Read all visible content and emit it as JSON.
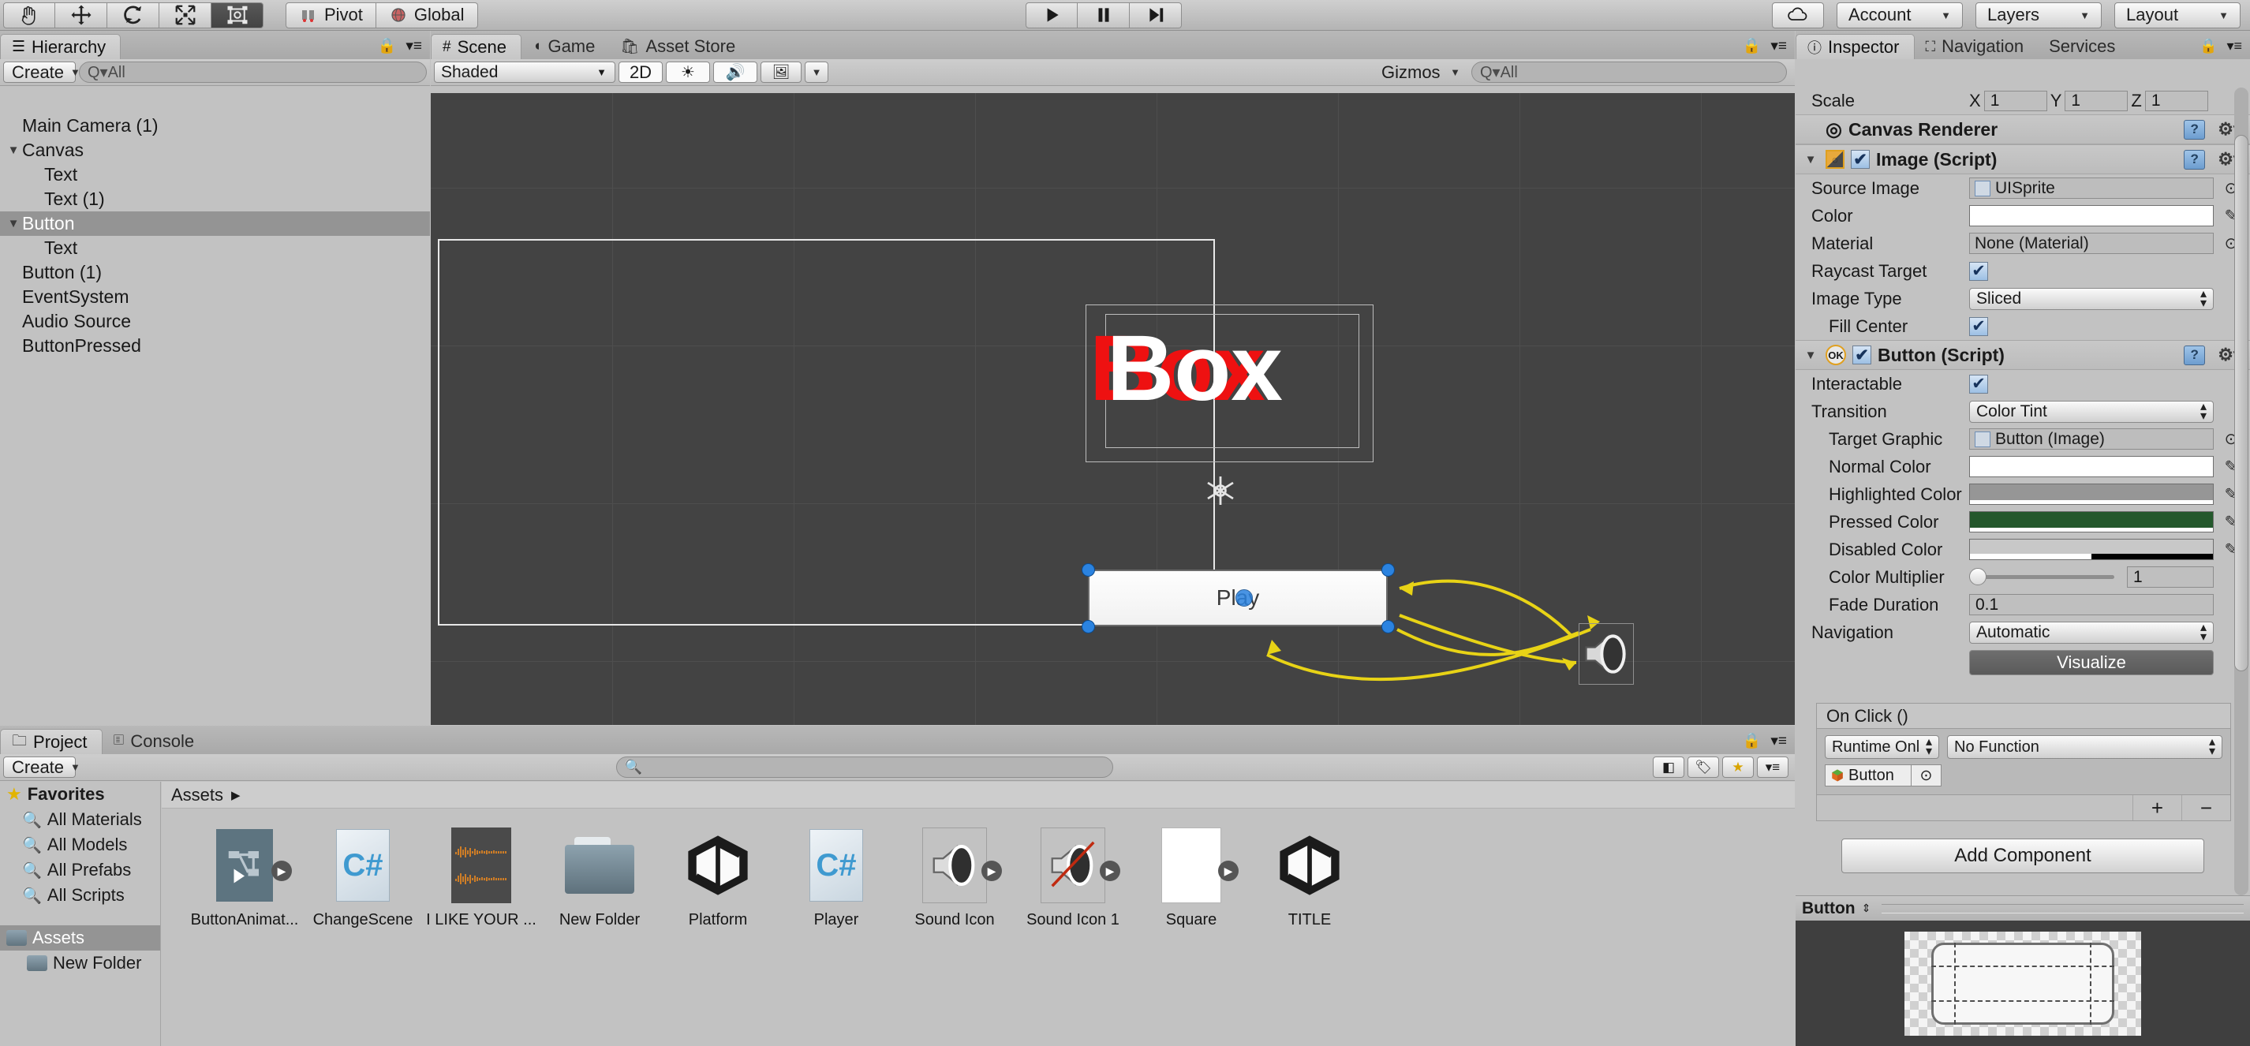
{
  "toolbar": {
    "tools": [
      {
        "name": "hand-tool",
        "glyph": "✋"
      },
      {
        "name": "move-tool",
        "glyph": "✥"
      },
      {
        "name": "rotate-tool",
        "glyph": "↻"
      },
      {
        "name": "scale-tool",
        "glyph": "⤢"
      },
      {
        "name": "rect-tool",
        "glyph": "⬚"
      }
    ],
    "pivot_label": "Pivot",
    "global_label": "Global",
    "play_label": "▶",
    "pause_label": "❚❚",
    "step_label": "▶❘",
    "cloud_label": "☁",
    "account_label": "Account",
    "layers_label": "Layers",
    "layout_label": "Layout"
  },
  "hierarchy": {
    "tab_label": "Hierarchy",
    "create_label": "Create",
    "search_placeholder": "Q▾All",
    "items": [
      {
        "label": "Main Camera (1)",
        "indent": 0,
        "foldout": "",
        "selected": false
      },
      {
        "label": "Canvas",
        "indent": 0,
        "foldout": "▼",
        "selected": false
      },
      {
        "label": "Text",
        "indent": 1,
        "foldout": "",
        "selected": false
      },
      {
        "label": "Text (1)",
        "indent": 1,
        "foldout": "",
        "selected": false
      },
      {
        "label": "Button",
        "indent": 0,
        "foldout": "▼",
        "selected": true
      },
      {
        "label": "Text",
        "indent": 1,
        "foldout": "",
        "selected": false
      },
      {
        "label": "Button (1)",
        "indent": 0,
        "foldout": "",
        "selected": false
      },
      {
        "label": "EventSystem",
        "indent": 0,
        "foldout": "",
        "selected": false
      },
      {
        "label": "Audio Source",
        "indent": 0,
        "foldout": "",
        "selected": false
      },
      {
        "label": "ButtonPressed",
        "indent": 0,
        "foldout": "",
        "selected": false
      }
    ]
  },
  "scene": {
    "tabs": [
      {
        "label": "Scene",
        "icon": "grid-icon",
        "active": true
      },
      {
        "label": "Game",
        "icon": "gamepad-icon",
        "active": false
      },
      {
        "label": "Asset Store",
        "icon": "store-icon",
        "active": false
      }
    ],
    "shading_mode": "Shaded",
    "mode_2d": "2D",
    "lighting_icon": "☀",
    "audio_icon": "🔊",
    "effects_icon": "🖼",
    "gizmos_label": "Gizmos",
    "search_placeholder": "Q▾All",
    "box_text": "Box",
    "play_button_text": "Play"
  },
  "inspector": {
    "tabs": [
      {
        "label": "Inspector",
        "active": true
      },
      {
        "label": "Navigation",
        "active": false
      },
      {
        "label": "Services",
        "active": false
      }
    ],
    "scale": {
      "label": "Scale",
      "x_label": "X",
      "x": "1",
      "y_label": "Y",
      "y": "1",
      "z_label": "Z",
      "z": "1"
    },
    "components": [
      {
        "name": "Canvas Renderer",
        "icon": "target-icon",
        "has_foldout": false,
        "has_checkbox": false,
        "rows": []
      },
      {
        "name": "Image (Script)",
        "icon": "image-script-icon",
        "has_foldout": true,
        "has_checkbox": true,
        "checked": true,
        "rows": [
          {
            "label": "Source Image",
            "type": "object",
            "value": "UISprite",
            "icon": "sprite-icon",
            "indent": 0
          },
          {
            "label": "Color",
            "type": "color",
            "value": "#ffffff",
            "indent": 0
          },
          {
            "label": "Material",
            "type": "object",
            "value": "None (Material)",
            "icon": "",
            "indent": 0
          },
          {
            "label": "Raycast Target",
            "type": "checkbox",
            "value": true,
            "indent": 0
          },
          {
            "label": "Image Type",
            "type": "popup",
            "value": "Sliced",
            "indent": 0
          },
          {
            "label": "Fill Center",
            "type": "checkbox",
            "value": true,
            "indent": 1
          }
        ]
      },
      {
        "name": "Button (Script)",
        "icon": "ok-script-icon",
        "has_foldout": true,
        "has_checkbox": true,
        "checked": true,
        "rows": [
          {
            "label": "Interactable",
            "type": "checkbox",
            "value": true,
            "indent": 0
          },
          {
            "label": "Transition",
            "type": "popup",
            "value": "Color Tint",
            "indent": 0
          },
          {
            "label": "Target Graphic",
            "type": "object",
            "value": "Button (Image)",
            "icon": "sprite-icon",
            "indent": 1
          },
          {
            "label": "Normal Color",
            "type": "color",
            "value": "#ffffff",
            "indent": 1
          },
          {
            "label": "Highlighted Color",
            "type": "color",
            "value": "#969696",
            "indent": 1
          },
          {
            "label": "Pressed Color",
            "type": "color",
            "value": "#24582c",
            "indent": 1
          },
          {
            "label": "Disabled Color",
            "type": "color",
            "value": "#c8c8c8",
            "alpha": 0.5,
            "indent": 1
          },
          {
            "label": "Color Multiplier",
            "type": "slider",
            "value": "1",
            "indent": 1
          },
          {
            "label": "Fade Duration",
            "type": "text",
            "value": "0.1",
            "indent": 1
          },
          {
            "label": "Navigation",
            "type": "popup",
            "value": "Automatic",
            "indent": 0
          },
          {
            "label": "",
            "type": "button",
            "value": "Visualize",
            "indent": 0
          }
        ]
      }
    ],
    "on_click": {
      "title": "On Click ()",
      "mode": "Runtime Onl",
      "function": "No Function",
      "target": "Button",
      "add_label": "+",
      "remove_label": "−"
    },
    "add_component_label": "Add Component"
  },
  "project": {
    "tabs": [
      {
        "label": "Project",
        "active": true
      },
      {
        "label": "Console",
        "active": false
      }
    ],
    "create_label": "Create",
    "search_placeholder": "",
    "breadcrumb": [
      "Assets"
    ],
    "favorites_label": "Favorites",
    "favorites": [
      "All Materials",
      "All Models",
      "All Prefabs",
      "All Scripts"
    ],
    "folders": [
      {
        "label": "Assets",
        "indent": 0,
        "selected": true
      },
      {
        "label": "New Folder",
        "indent": 1,
        "selected": false
      }
    ],
    "assets": [
      {
        "label": "ButtonAnimat...",
        "icon": "animator-controller-icon",
        "has_sub": true
      },
      {
        "label": "ChangeScene",
        "icon": "csharp-script-icon",
        "has_sub": false
      },
      {
        "label": "I LIKE YOUR ...",
        "icon": "audio-clip-icon",
        "has_sub": false
      },
      {
        "label": "New Folder",
        "icon": "folder-icon",
        "has_sub": false
      },
      {
        "label": "Platform",
        "icon": "prefab-icon",
        "has_sub": false
      },
      {
        "label": "Player",
        "icon": "csharp-script-icon",
        "has_sub": false
      },
      {
        "label": "Sound Icon",
        "icon": "speaker-texture-icon",
        "has_sub": true
      },
      {
        "label": "Sound Icon 1",
        "icon": "speaker-muted-texture-icon",
        "has_sub": true
      },
      {
        "label": "Square",
        "icon": "white-square-texture-icon",
        "has_sub": true
      },
      {
        "label": "TITLE",
        "icon": "prefab-icon",
        "has_sub": false
      }
    ]
  },
  "preview": {
    "label": "Button"
  }
}
